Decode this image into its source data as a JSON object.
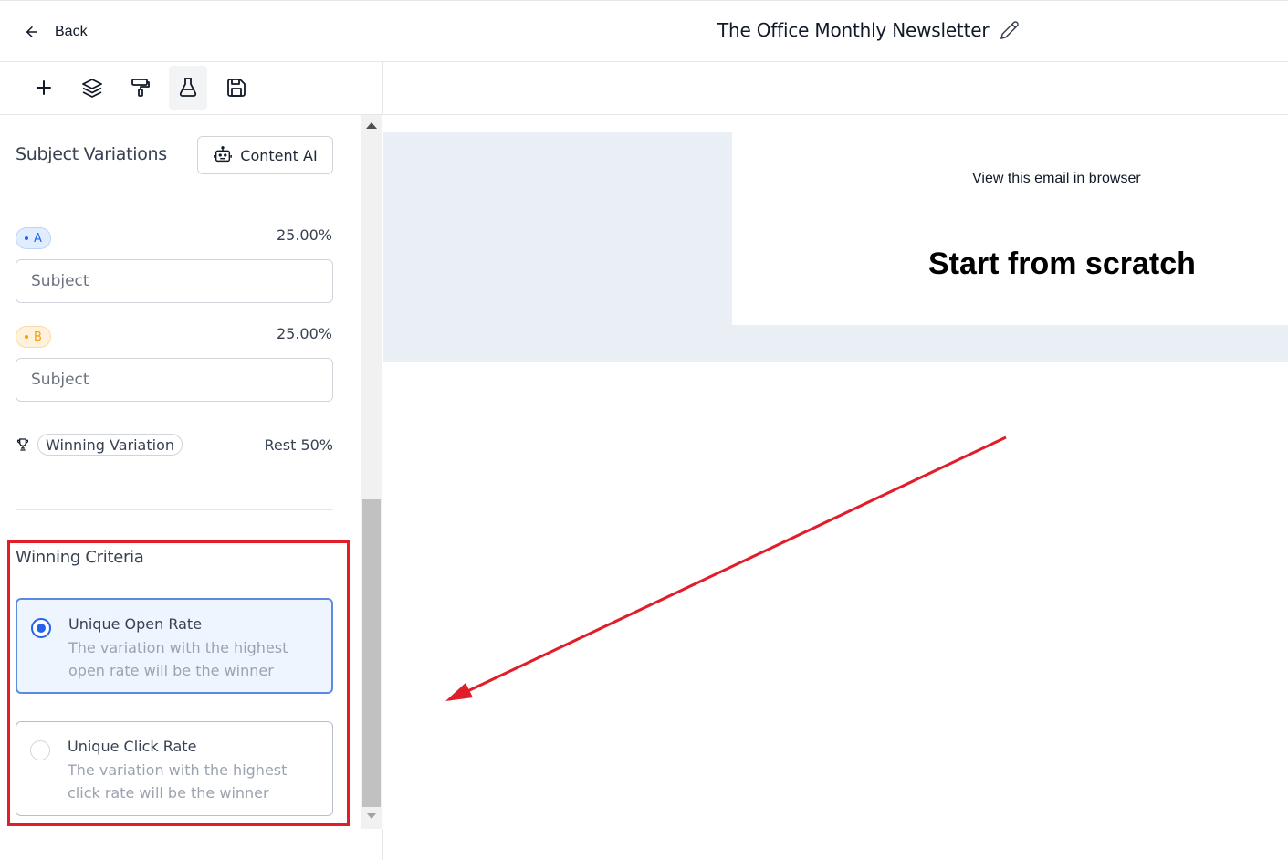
{
  "header": {
    "back_label": "Back",
    "title": "The Office Monthly Newsletter"
  },
  "toolbar": {
    "tools": [
      "add-icon",
      "layers-icon",
      "paint-roller-icon",
      "flask-icon",
      "save-icon"
    ],
    "active_tool": "flask-icon"
  },
  "sidebar": {
    "section_title": "Subject Variations",
    "content_ai_label": "Content AI",
    "variation_a": {
      "badge": "A",
      "percent": "25.00%",
      "placeholder": "Subject"
    },
    "variation_b": {
      "badge": "B",
      "percent": "25.00%",
      "placeholder": "Subject"
    },
    "winning_variation_label": "Winning Variation",
    "rest_label": "Rest 50%",
    "criteria_title": "Winning Criteria",
    "criteria": [
      {
        "title": "Unique Open Rate",
        "description": "The variation with the highest open rate will be the winner",
        "selected": true
      },
      {
        "title": "Unique Click Rate",
        "description": "The variation with the highest click rate will be the winner",
        "selected": false
      }
    ]
  },
  "canvas": {
    "view_in_browser": "View this email in browser",
    "heading": "Start from scratch"
  },
  "colors": {
    "accent": "#2563eb",
    "annotation": "#e11d2a",
    "email_background": "#eaeef5",
    "badge_a": "#2563eb",
    "badge_b": "#f59e0b"
  }
}
